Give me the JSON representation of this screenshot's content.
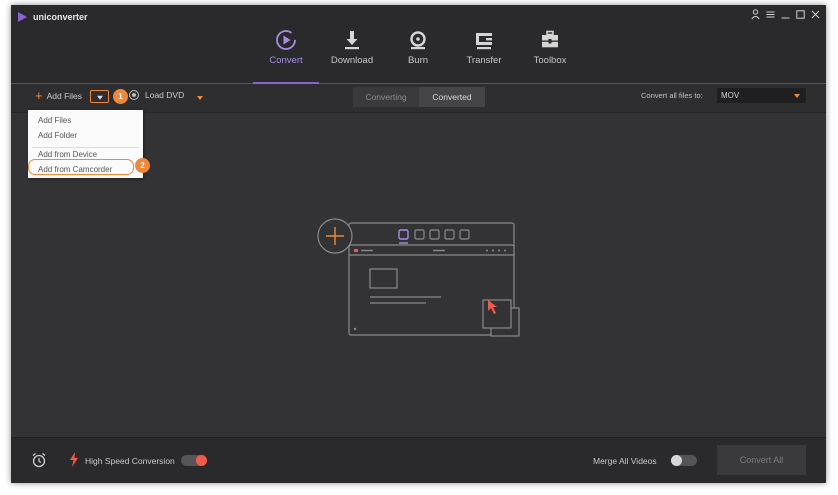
{
  "app": {
    "title": "uniconverter"
  },
  "nav": [
    {
      "label": "Convert",
      "icon": "convert-icon",
      "active": true
    },
    {
      "label": "Download",
      "icon": "download-icon"
    },
    {
      "label": "Burn",
      "icon": "burn-icon"
    },
    {
      "label": "Transfer",
      "icon": "transfer-icon"
    },
    {
      "label": "Toolbox",
      "icon": "toolbox-icon"
    }
  ],
  "toolbar": {
    "add_files": "Add Files",
    "load_dvd": "Load DVD",
    "tabs": [
      {
        "label": "Converting"
      },
      {
        "label": "Converted",
        "active": true
      }
    ],
    "convert_all_to": "Convert all files to:",
    "format": "MOV"
  },
  "dropdown_menu": {
    "items": [
      "Add Files",
      "Add Folder",
      "Add from Device",
      "Add from Camcorder"
    ],
    "highlighted": "Add from Camcorder"
  },
  "annotations": {
    "step1": "1",
    "step2": "2"
  },
  "bottom": {
    "high_speed_label": "High Speed Conversion",
    "high_speed_on": true,
    "merge_label": "Merge All Videos",
    "merge_on": false,
    "convert_all_label": "Convert All"
  },
  "colors": {
    "accent": "#8a63d2",
    "highlight": "#f0883a",
    "toggle_on": "#f25a4a",
    "background": "#333335"
  }
}
